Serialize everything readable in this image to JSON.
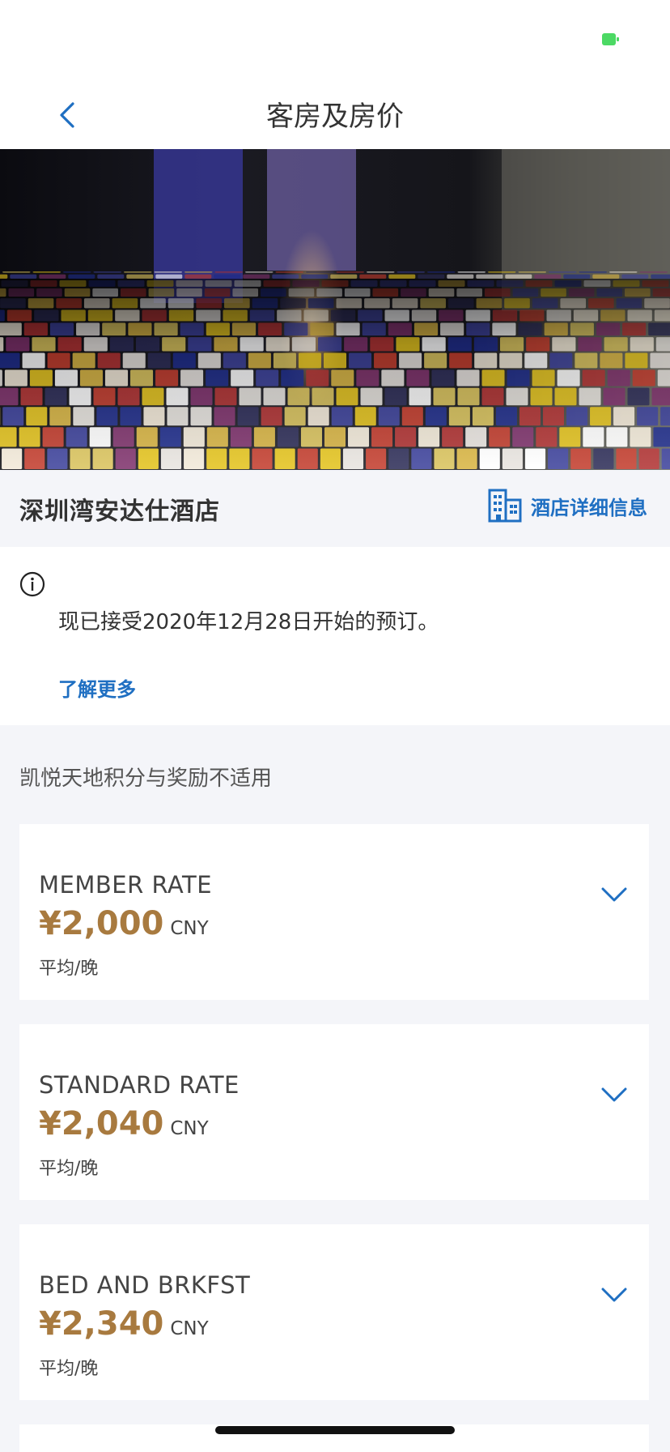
{
  "status_bar": {
    "battery_color": "#4cd964"
  },
  "nav": {
    "title": "客房及房价",
    "back_icon": "chevron-left-icon"
  },
  "hotel": {
    "name": "深圳湾安达仕酒店",
    "details_label": "酒店详细信息",
    "details_icon": "building-icon"
  },
  "notice": {
    "icon": "info-circle-icon",
    "text": "现已接受2020年12月28日开始的预订。",
    "learn_more_label": "了解更多"
  },
  "points_note": "凯悦天地积分与奖励不适用",
  "rates": [
    {
      "name": "MEMBER RATE",
      "price": "¥2,000",
      "currency": "CNY",
      "unit": "平均/晚"
    },
    {
      "name": "STANDARD RATE",
      "price": "¥2,040",
      "currency": "CNY",
      "unit": "平均/晚"
    },
    {
      "name": "BED AND BRKFST",
      "price": "¥2,340",
      "currency": "CNY",
      "unit": "平均/晚"
    }
  ],
  "colors": {
    "accent_blue": "#1f6fc2",
    "price_gold": "#a87a3f",
    "background": "#f4f5f9"
  }
}
